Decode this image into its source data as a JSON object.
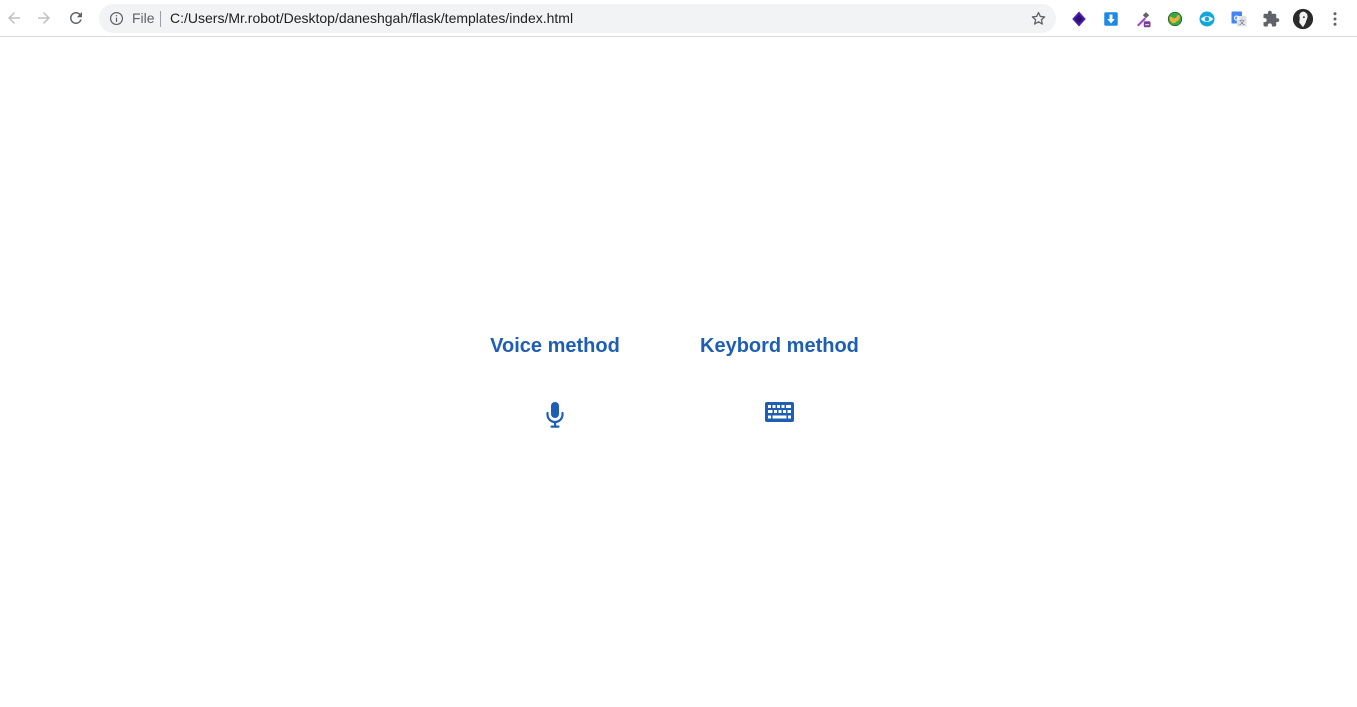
{
  "browser": {
    "url_scheme_label": "File",
    "url": "C:/Users/Mr.robot/Desktop/daneshgah/flask/templates/index.html",
    "extensions": [
      "purple-stack-extension-icon",
      "download-extension-icon",
      "eyedropper-extension-icon",
      "globe-extension-icon",
      "eye-extension-icon",
      "translate-extension-icon",
      "puzzle-extensions-icon",
      "profile-avatar",
      "more-menu-icon"
    ]
  },
  "page": {
    "voice": {
      "title": "Voice method",
      "icon": "microphone-icon"
    },
    "keyboard": {
      "title": "Keybord method",
      "icon": "keyboard-icon"
    },
    "accent_color": "#1e5fb4"
  }
}
